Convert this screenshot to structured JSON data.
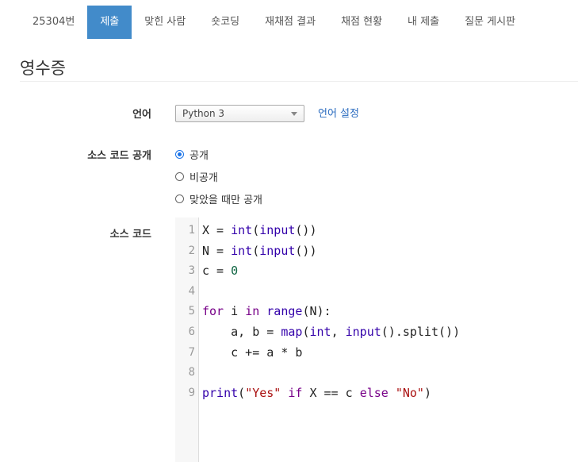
{
  "tabs": [
    {
      "label": "25304번",
      "active": false
    },
    {
      "label": "제출",
      "active": true
    },
    {
      "label": "맞힌 사람",
      "active": false
    },
    {
      "label": "숏코딩",
      "active": false
    },
    {
      "label": "재채점 결과",
      "active": false
    },
    {
      "label": "채점 현황",
      "active": false
    },
    {
      "label": "내 제출",
      "active": false
    },
    {
      "label": "질문 게시판",
      "active": false
    }
  ],
  "page_title": "영수증",
  "form": {
    "language_label": "언어",
    "language_value": "Python 3",
    "language_settings_link": "언어 설정",
    "visibility_label": "소스 코드 공개",
    "visibility_options": [
      "공개",
      "비공개",
      "맞았을 때만 공개"
    ],
    "visibility_selected": 0,
    "source_label": "소스 코드"
  },
  "code_lines": [
    "X = int(input())",
    "N = int(input())",
    "c = 0",
    "",
    "for i in range(N):",
    "    a, b = map(int, input().split())",
    "    c += a * b",
    "",
    "print(\"Yes\" if X == c else \"No\")"
  ],
  "colors": {
    "accent": "#428bca",
    "link": "#2a6bbf",
    "keyword": "#770088",
    "builtin": "#3300aa",
    "number": "#116644",
    "string": "#aa1111"
  }
}
